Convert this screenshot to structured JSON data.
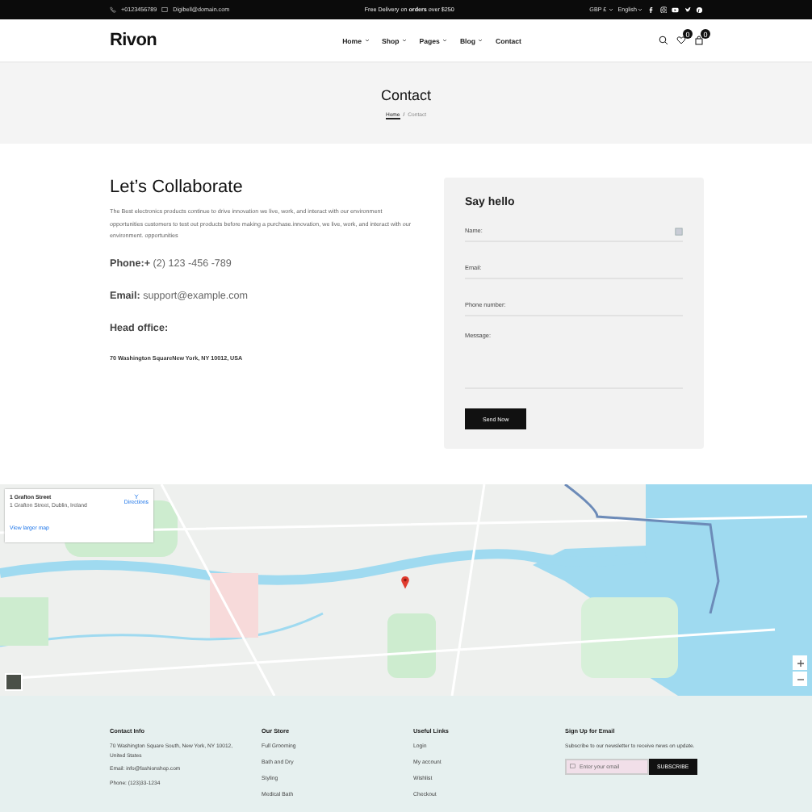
{
  "topbar": {
    "phone": "+0123456789",
    "email": "Digibell@domain.com",
    "promo": "Free Delivery on **orders** over $250",
    "currency": "GBP £",
    "language": "English"
  },
  "header": {
    "logo": "Rivon",
    "nav": [
      {
        "label": "Home",
        "dropdown": true
      },
      {
        "label": "Shop",
        "dropdown": true
      },
      {
        "label": "Pages",
        "dropdown": true
      },
      {
        "label": "Blog",
        "dropdown": true
      },
      {
        "label": "Contact",
        "dropdown": false
      }
    ],
    "wishlist_count": "0",
    "cart_count": "0"
  },
  "banner": {
    "title": "Contact",
    "separator": "/",
    "breadcrumb": [
      {
        "label": "Home",
        "link": true
      },
      {
        "label": "Contact",
        "link": false
      }
    ]
  },
  "contact": {
    "heading": "Let’s Collaborate",
    "intro": "The Best electronics products continue to drive innovation we live, work, and interact with our environment opportunities customers to test out products before making a purchase.innovation, we live, work, and interact with our environment. opportunities",
    "phone_label": "Phone:+",
    "phone": "(2) 123 -456 -789",
    "email_label": "Email:",
    "email": "support@example.com",
    "office_label": "Head office:",
    "office_address": "70 Washington SquareNew York, NY 10012, USA"
  },
  "form": {
    "title": "Say hello",
    "fields": [
      {
        "label": "Name:",
        "kind": "input",
        "autofill": true
      },
      {
        "label": "Email:",
        "kind": "input",
        "autofill": false
      },
      {
        "label": "Phone number:",
        "kind": "input",
        "autofill": false
      },
      {
        "label": "Message:",
        "kind": "textarea",
        "autofill": false
      }
    ],
    "button": "Send Now"
  },
  "map": {
    "place_name": "1 Grafton Street",
    "place_address": "1 Grafton Street, Dublin, Ireland",
    "directions": "Directions",
    "larger_map": "View larger map"
  },
  "footer": [
    {
      "heading": "Contact Info",
      "kind": "text",
      "lines": [
        "70 Washington Square South, New York, NY 10012, United States",
        "Email: info@fashionshop.com",
        "Phone: (123)33-1234"
      ]
    },
    {
      "heading": "Our Store",
      "kind": "links",
      "lines": [
        "Full Grooming",
        "Bath and Dry",
        "Styling",
        "Medical Bath"
      ]
    },
    {
      "heading": "Useful Links",
      "kind": "links",
      "lines": [
        "Login",
        "My account",
        "Wishlist",
        "Checkout"
      ]
    },
    {
      "heading": "Sign Up for Email",
      "kind": "newsletter",
      "text": "Subscribe to our newsletter to receive news on update.",
      "placeholder": "Enter your email",
      "button": "SUBSCRIBE"
    }
  ]
}
